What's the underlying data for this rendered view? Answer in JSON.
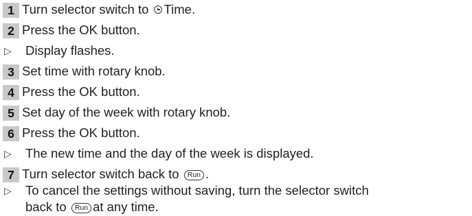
{
  "steps": [
    {
      "number": "1",
      "text": "Turn selector switch to",
      "symbol": "clock-icon",
      "text_after": "Time."
    },
    {
      "number": "2",
      "text": "Press the OK button."
    },
    {
      "result": "Display flashes."
    },
    {
      "number": "3",
      "text": "Set time with rotary knob."
    },
    {
      "number": "4",
      "text": "Press the OK button."
    },
    {
      "number": "5",
      "text": "Set day of the week with rotary knob."
    },
    {
      "number": "6",
      "text": "Press the OK button."
    },
    {
      "result": "The new time and the day of the week is displayed."
    },
    {
      "number": "7",
      "text": "Turn selector switch back to",
      "symbol_label": "Run",
      "text_after": "."
    },
    {
      "result": "To cancel the settings without saving, turn the selector switch",
      "result_cont_before": "back to",
      "symbol_label": "Run",
      "result_cont_after": "at any time."
    }
  ],
  "result_marker": "▷"
}
